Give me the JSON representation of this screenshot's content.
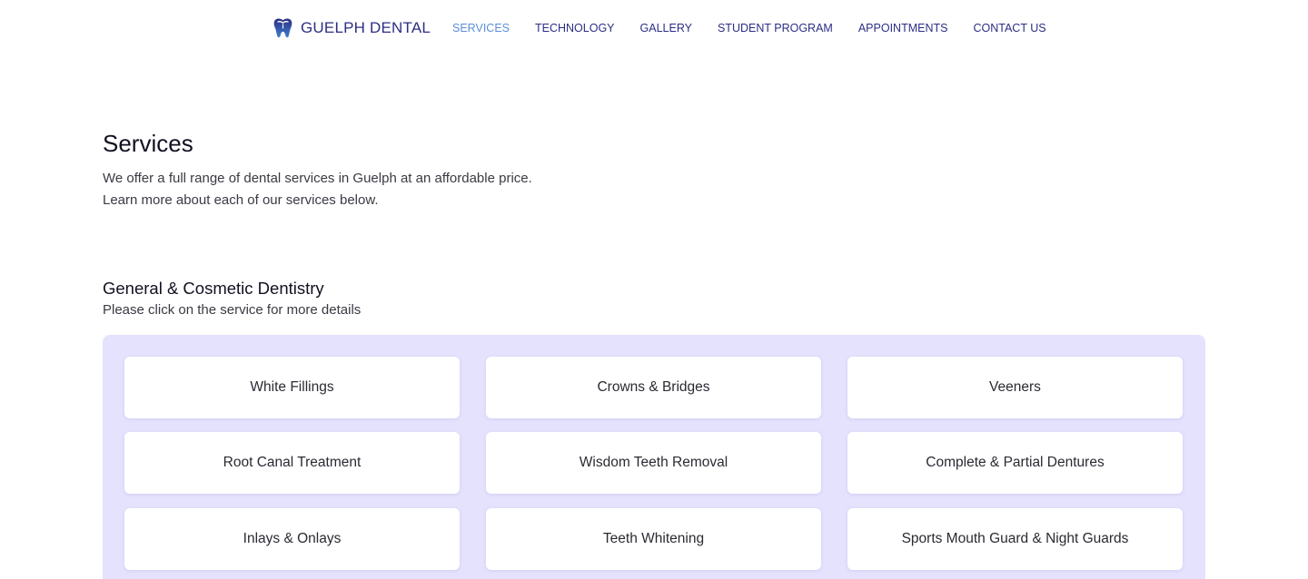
{
  "header": {
    "brand": "GUELPH DENTAL",
    "nav": [
      {
        "label": "SERVICES",
        "active": true
      },
      {
        "label": "TECHNOLOGY"
      },
      {
        "label": "GALLERY"
      },
      {
        "label": "STUDENT PROGRAM"
      },
      {
        "label": "APPOINTMENTS"
      },
      {
        "label": "CONTACT US"
      }
    ]
  },
  "main": {
    "title": "Services",
    "intro_line1": "We offer a full range of dental services in Guelph at an affordable price.",
    "intro_line2": "Learn more about each of our services below.",
    "section": {
      "title": "General & Cosmetic Dentistry",
      "subtitle": "Please click on the service for more details",
      "services": [
        "White Fillings",
        "Crowns & Bridges",
        "Veeners",
        "Root Canal Treatment",
        "Wisdom Teeth Removal",
        "Complete & Partial Dentures",
        "Inlays & Onlays",
        "Teeth Whitening",
        "Sports Mouth Guard & Night Guards"
      ]
    }
  },
  "colors": {
    "brand_navy": "#2c2e83",
    "active_link": "#5b8fd6",
    "panel_bg": "#e4e2fd"
  }
}
